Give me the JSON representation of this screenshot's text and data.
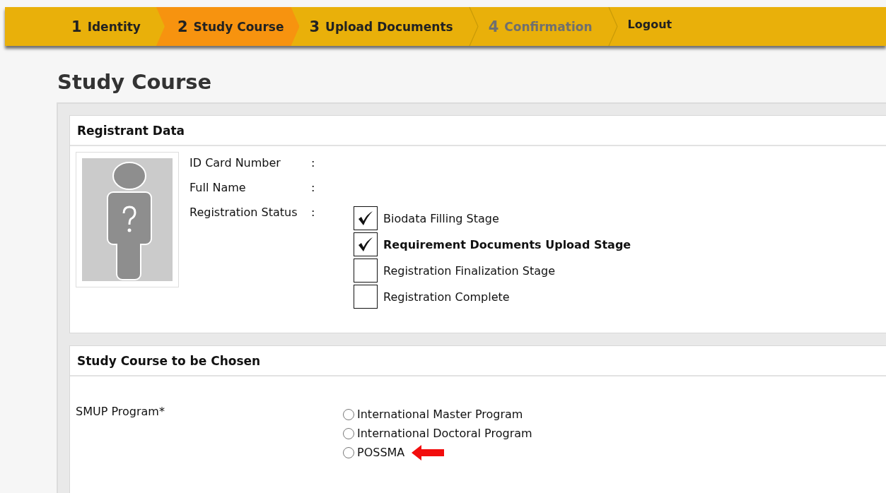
{
  "steps": [
    {
      "number": "1",
      "label": "Identity",
      "selected": false,
      "disabled": false
    },
    {
      "number": "2",
      "label": "Study Course",
      "selected": true,
      "disabled": false
    },
    {
      "number": "3",
      "label": "Upload Documents",
      "selected": false,
      "disabled": false
    },
    {
      "number": "4",
      "label": "Confirmation",
      "selected": false,
      "disabled": true
    }
  ],
  "logout": "Logout",
  "page_title": "Study Course",
  "registrant": {
    "title": "Registrant Data",
    "fields": [
      {
        "label": "ID Card Number",
        "separator": ":"
      },
      {
        "label": "Full Name",
        "separator": ":"
      },
      {
        "label": "Registration Status",
        "separator": ":"
      }
    ],
    "stages": [
      {
        "label": "Biodata Filling Stage",
        "checked": true,
        "current": false
      },
      {
        "label": "Requirement Documents Upload Stage",
        "checked": true,
        "current": true
      },
      {
        "label": "Registration Finalization Stage",
        "checked": false,
        "current": false
      },
      {
        "label": "Registration Complete",
        "checked": false,
        "current": false
      }
    ]
  },
  "course": {
    "title": "Study Course to be Chosen",
    "field_label": "SMUP Program*",
    "options": [
      {
        "label": "International Master Program",
        "selected": false,
        "pointed": false
      },
      {
        "label": "International Doctoral Program",
        "selected": false,
        "pointed": false
      },
      {
        "label": "POSSMA",
        "selected": false,
        "pointed": true
      }
    ]
  }
}
